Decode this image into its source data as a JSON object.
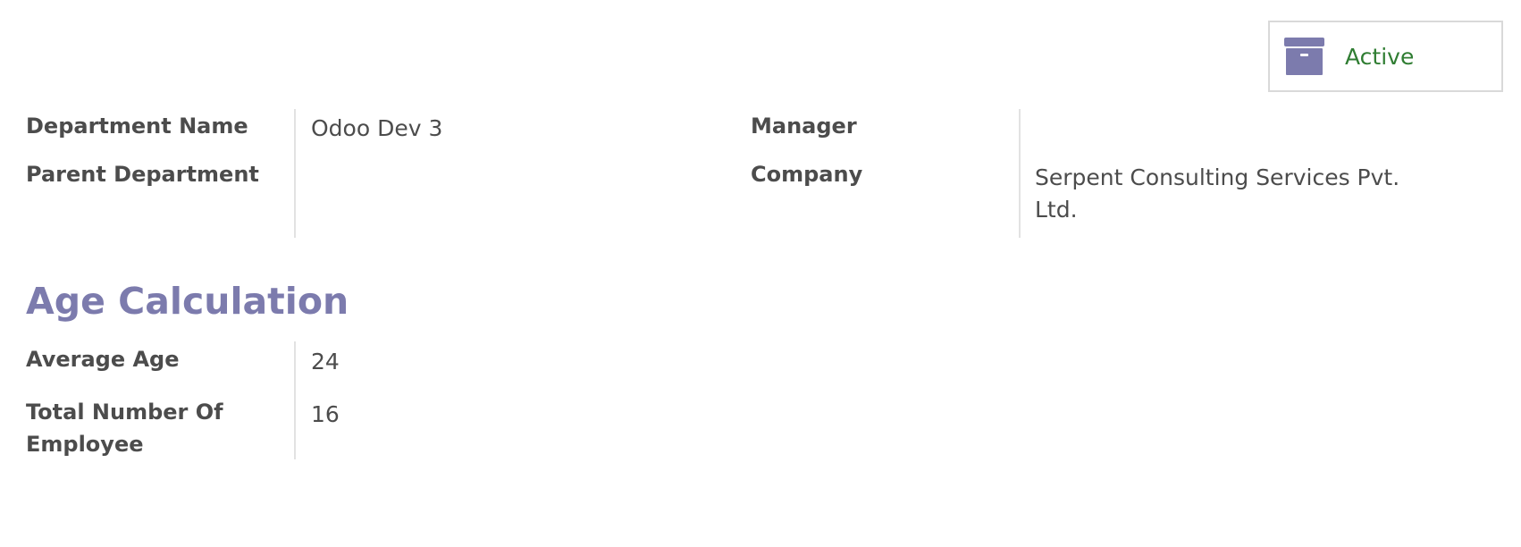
{
  "toggle": {
    "label": "Active",
    "icon": "archive-icon",
    "label_color": "#2f7d32",
    "icon_color": "#7c7bad"
  },
  "left_group": {
    "department_name_label": "Department Name",
    "department_name_value": "Odoo Dev 3",
    "parent_department_label": "Parent Department",
    "parent_department_value": ""
  },
  "right_group": {
    "manager_label": "Manager",
    "manager_value": "",
    "company_label": "Company",
    "company_value_line1": "Serpent Consulting Services Pvt.",
    "company_value_line2": "Ltd."
  },
  "age_section": {
    "title": "Age Calculation",
    "title_color": "#7c7bad",
    "average_age_label": "Average Age",
    "average_age_value": "24",
    "total_employee_label_line1": "Total Number Of",
    "total_employee_label_line2": "Employee",
    "total_employee_value": "16"
  }
}
